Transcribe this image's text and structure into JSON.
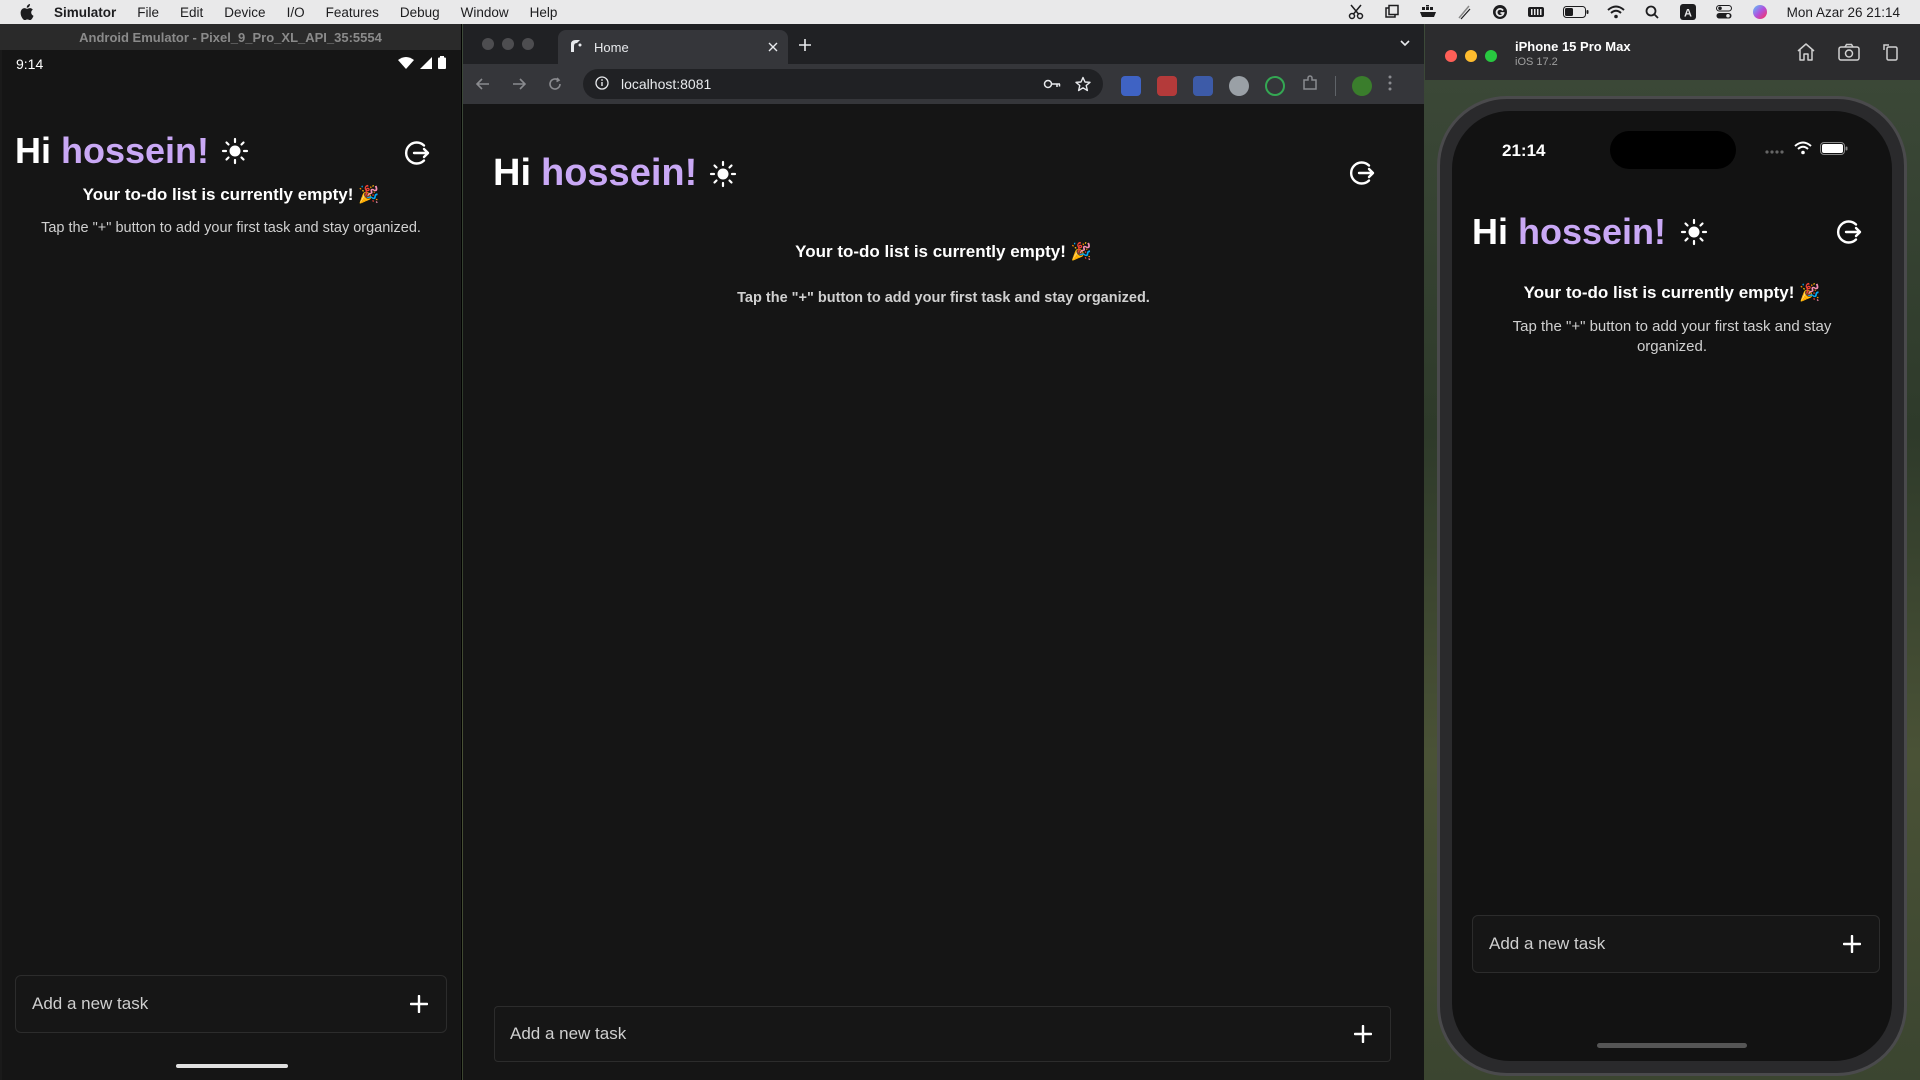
{
  "menubar": {
    "app_name": "Simulator",
    "items": [
      "File",
      "Edit",
      "Device",
      "I/O",
      "Features",
      "Debug",
      "Window",
      "Help"
    ],
    "clock": "Mon Azar 26  21:14"
  },
  "android": {
    "window_title": "Android Emulator - Pixel_9_Pro_XL_API_35:5554",
    "status_time": "9:14"
  },
  "app": {
    "greeting_hi": "Hi",
    "greeting_name": "hossein!",
    "empty_title": "Your to-do list is currently empty! 🎉",
    "empty_subtitle": "Tap the \"+\" button to add your first task and stay organized.",
    "add_placeholder": "Add a new task",
    "name_color": "#c9a8f5"
  },
  "chrome": {
    "tab_title": "Home",
    "url": "localhost:8081"
  },
  "iphone": {
    "device_name": "iPhone 15 Pro Max",
    "os_version": "iOS 17.2",
    "status_time": "21:14"
  }
}
